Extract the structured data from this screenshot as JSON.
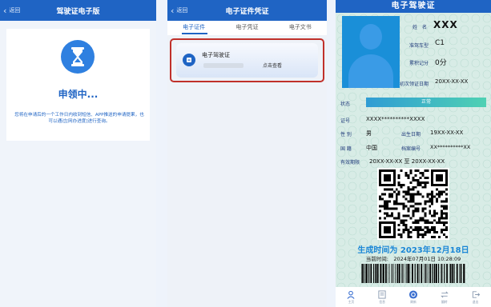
{
  "panel1": {
    "back_label": "返回",
    "title": "驾驶证电子版",
    "status_title": "申领中...",
    "status_desc": "您将在申请后的一个工作日内收到短信、APP推送的申请提果，也可以通过[网办进度]进行查询。"
  },
  "panel2": {
    "back_label": "返回",
    "title": "电子证件凭证",
    "tabs": [
      {
        "label": "电子证件"
      },
      {
        "label": "电子凭证"
      },
      {
        "label": "电子文书"
      }
    ],
    "active_tab": 0,
    "cert": {
      "name": "电子驾驶证",
      "action": "点击查看"
    }
  },
  "panel3": {
    "header": "电子驾驶证",
    "name_label": "姓　名",
    "name_value": "XXX",
    "class_label": "准驾车型",
    "class_value": "C1",
    "points_label": "累积记分",
    "points_value": "0分",
    "first_issue_label": "初次领证日期",
    "first_issue_value": "20XX-XX-XX",
    "status_label": "状态",
    "status_value": "正常",
    "id_label": "证号",
    "id_value": "XXXX**********XXXX",
    "sex_label": "性 别",
    "sex_value": "男",
    "birth_label": "出生日期",
    "birth_value": "19XX-XX-XX",
    "nation_label": "国 籍",
    "nation_value": "中国",
    "file_label": "档案编号",
    "file_value": "XX**********XX",
    "valid_label": "有效期限",
    "valid_value": "20XX-XX-XX 至 20XX-XX-XX",
    "generated": "生成时间为 2023年12月18日",
    "current_time": "当前时间:　2024年07月01日 10:28:09",
    "tabbar": [
      {
        "label": "主页",
        "icon": "person-icon"
      },
      {
        "label": "信息",
        "icon": "document-icon"
      },
      {
        "label": "刷新",
        "icon": "refresh-icon"
      },
      {
        "label": "翻转",
        "icon": "flip-icon"
      },
      {
        "label": "退出",
        "icon": "exit-icon"
      }
    ]
  },
  "colors": {
    "nav": "#1f64c4",
    "accent": "#2f80e0",
    "highlight_border": "#c0302a",
    "generated_text": "#1a86d6"
  }
}
